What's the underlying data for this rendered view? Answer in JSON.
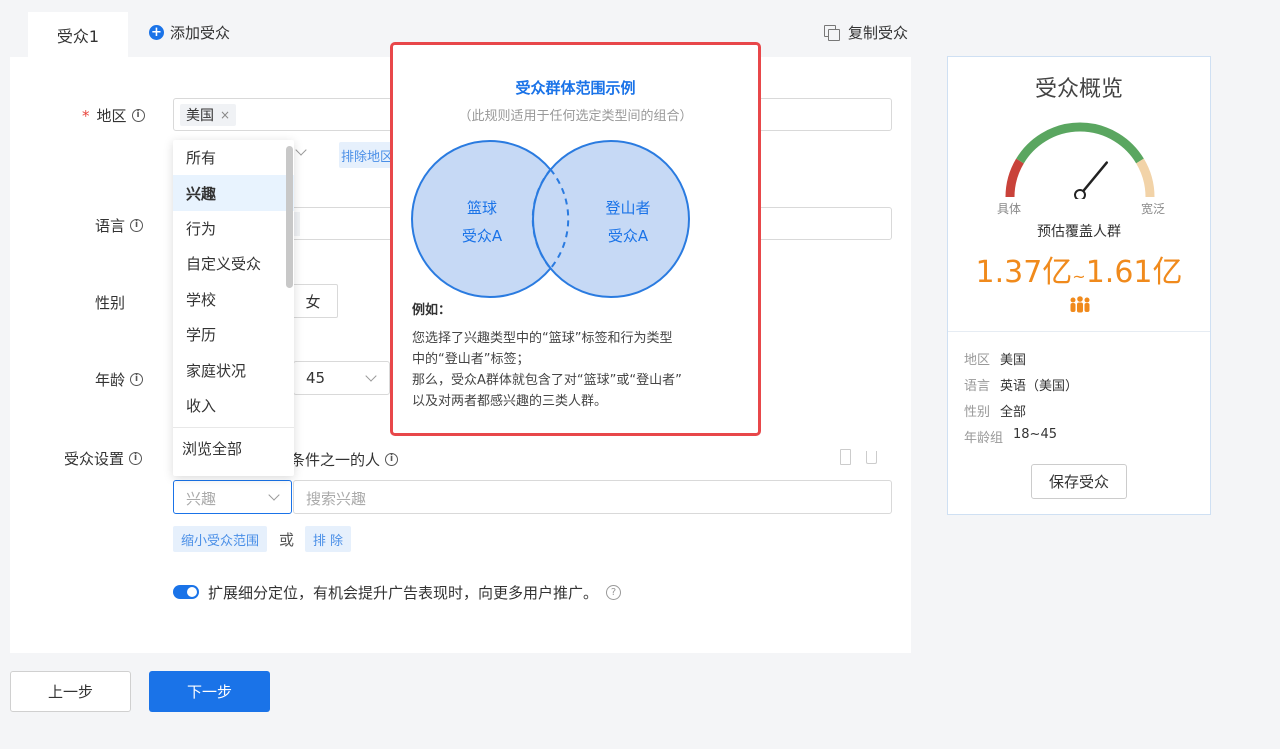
{
  "tabs": {
    "active": "受众1",
    "add": "添加受众",
    "copy": "复制受众"
  },
  "form": {
    "region": {
      "label": "地区",
      "tag": "美国",
      "exclude_chip": "排除地区"
    },
    "language": {
      "label": "语言"
    },
    "gender": {
      "label": "性别",
      "female": "女"
    },
    "age": {
      "label": "年龄",
      "max": "45"
    },
    "audience_settings": {
      "label": "受众设置",
      "condition_text": "条件之一的人",
      "type_select": "兴趣",
      "search_placeholder": "搜索兴趣",
      "narrow": "缩小受众范围",
      "or": "或",
      "exclude": "排 除"
    },
    "expand_text": "扩展细分定位，有机会提升广告表现时，向更多用户推广。"
  },
  "dropdown": {
    "items": [
      "所有",
      "兴趣",
      "行为",
      "自定义受众",
      "学校",
      "学历",
      "家庭状况",
      "收入"
    ],
    "footer": "浏览全部"
  },
  "popup": {
    "title": "受众群体范围示例",
    "subtitle": "（此规则适用于任何选定类型间的组合）",
    "circle_left": [
      "篮球",
      "受众A"
    ],
    "circle_right": [
      "登山者",
      "受众A"
    ],
    "example_head": "例如：",
    "example_lines": [
      "您选择了兴趣类型中的“篮球”标签和行为类型",
      "中的“登山者”标签；",
      "那么，受众A群体就包含了对“篮球”或“登山者”",
      "以及对两者都感兴趣的三类人群。"
    ]
  },
  "overview": {
    "title": "受众概览",
    "gauge_left": "具体",
    "gauge_right": "宽泛",
    "coverage_label": "预估覆盖人群",
    "range_low": "1.37亿",
    "range_sep": "~",
    "range_high": "1.61亿",
    "gauge_level": 0.72,
    "rows": [
      {
        "key": "地区",
        "value": "美国"
      },
      {
        "key": "语言",
        "value": "英语（美国）"
      },
      {
        "key": "性别",
        "value": "全部"
      },
      {
        "key": "年龄组",
        "value": "18~45"
      }
    ],
    "save": "保存受众"
  },
  "buttons": {
    "prev": "上一步",
    "next": "下一步"
  },
  "colors": {
    "accent": "#1a73e8",
    "popup_border": "#e8474a",
    "coverage": "#f08a1c"
  }
}
